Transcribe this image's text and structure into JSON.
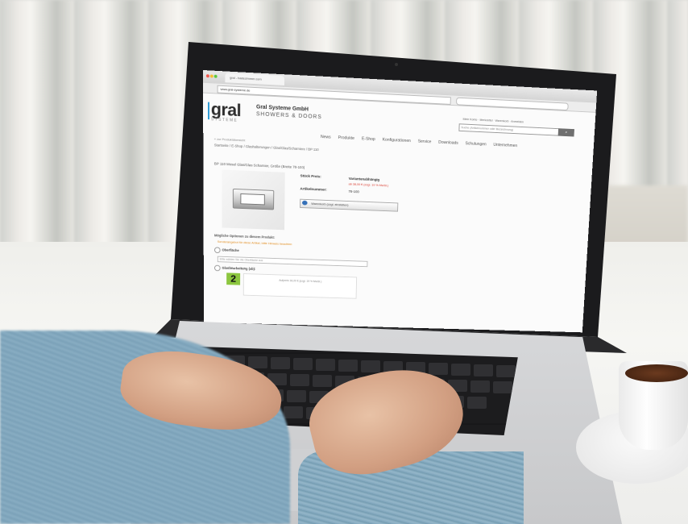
{
  "browser": {
    "tab_title": "gral - badezimmer.com",
    "url": "www.gral-systeme.de"
  },
  "site": {
    "logo": "gral",
    "logo_sub": "SYSTEME",
    "company": "Gral Systeme GmbH",
    "company_sub": "SHOWERS & DOORS",
    "top_links": "Mein Konto · Merkzettel · Warenkorb · Anmelden",
    "search_placeholder": "Suche (Artikelnummer oder Bezeichnung)",
    "nav": [
      "News",
      "Produkte",
      "E-Shop",
      "Konfigurationen",
      "Service",
      "Downloads",
      "Schulungen",
      "Unternehmen"
    ],
    "breadcrumb_back": "« zur Produktübersicht",
    "breadcrumb": "Startseite / E-Shop / Glashalterungen / Glas/Glas/Scharniere / BP 110"
  },
  "product": {
    "title": "BP 110 Mosel Glas/Glas Scharnier, Größe (Breite 78-100)",
    "price_label": "Stück Preis:",
    "price_value": "Variantenabhängig",
    "price_note": "ab 38,00 € (zzgl. 19 % MwSt.)",
    "article_label": "Artikelnummer:",
    "article_value": "78-100",
    "cart_button": "Warenkorb (zzgl. einstellen)"
  },
  "options": {
    "section_title": "Mögliche Optionen zu diesem Produkt:",
    "note": "Sonderangebot für diese Artikel, bitte Hinweis beachten",
    "option1_label": "Oberfläche",
    "option1_placeholder": "Bitte wählen Sie die Oberfläche aus",
    "option2_label": "Glasbearbeitung (ab):",
    "badge": "2",
    "option2_price": "Aufpreis 18,20 € (zzgl. 19 % MwSt.)"
  }
}
